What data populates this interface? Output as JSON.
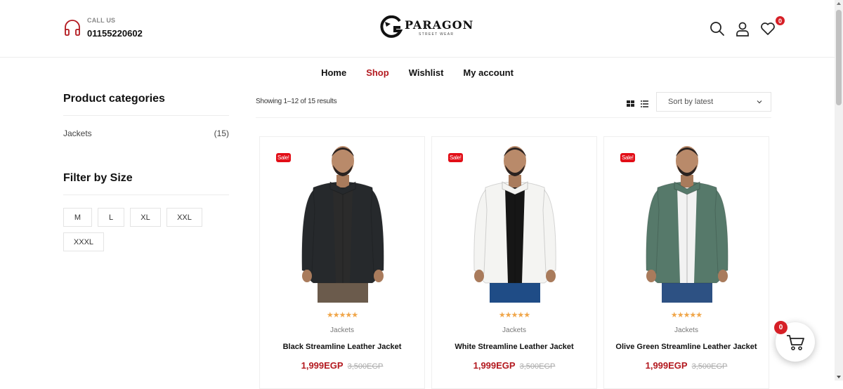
{
  "header": {
    "call_label": "CALL US",
    "phone": "01155220602",
    "logo_name": "PARAGON",
    "logo_tagline": "STREET WEAR",
    "wishlist_count": "0"
  },
  "nav": {
    "items": [
      {
        "label": "Home",
        "active": false
      },
      {
        "label": "Shop",
        "active": true
      },
      {
        "label": "Wishlist",
        "active": false
      },
      {
        "label": "My account",
        "active": false
      }
    ]
  },
  "sidebar": {
    "categories_title": "Product categories",
    "categories": [
      {
        "name": "Jackets",
        "count": "(15)"
      }
    ],
    "filter_title": "Filter by Size",
    "sizes": [
      "M",
      "L",
      "XL",
      "XXL",
      "XXXL"
    ]
  },
  "toolbar": {
    "result_count": "Showing 1–12 of 15 results",
    "sort_value": "Sort by latest"
  },
  "products": [
    {
      "sale": "Sale!",
      "rating": 5,
      "category": "Jackets",
      "name": "Black Streamline Leather Jacket",
      "price": "1,999EGP",
      "old_price": "3,500EGP",
      "jacket_color": "#26292c",
      "under_color": "#2b2b2b",
      "pants_color": "#6b5b4c"
    },
    {
      "sale": "Sale!",
      "rating": 5,
      "category": "Jackets",
      "name": "White Streamline Leather Jacket",
      "price": "1,999EGP",
      "old_price": "3,500EGP",
      "jacket_color": "#f4f4f2",
      "under_color": "#161616",
      "pants_color": "#1f4c86"
    },
    {
      "sale": "Sale!",
      "rating": 5,
      "category": "Jackets",
      "name": "Olive Green Streamline Leather Jacket",
      "price": "1,999EGP",
      "old_price": "3,500EGP",
      "jacket_color": "#56796a",
      "under_color": "#f2f2f2",
      "pants_color": "#2d5183"
    }
  ],
  "cart": {
    "count": "0"
  },
  "colors": {
    "accent": "#b3191f",
    "sale_badge": "#e20e17",
    "stars": "#f0a64a"
  }
}
